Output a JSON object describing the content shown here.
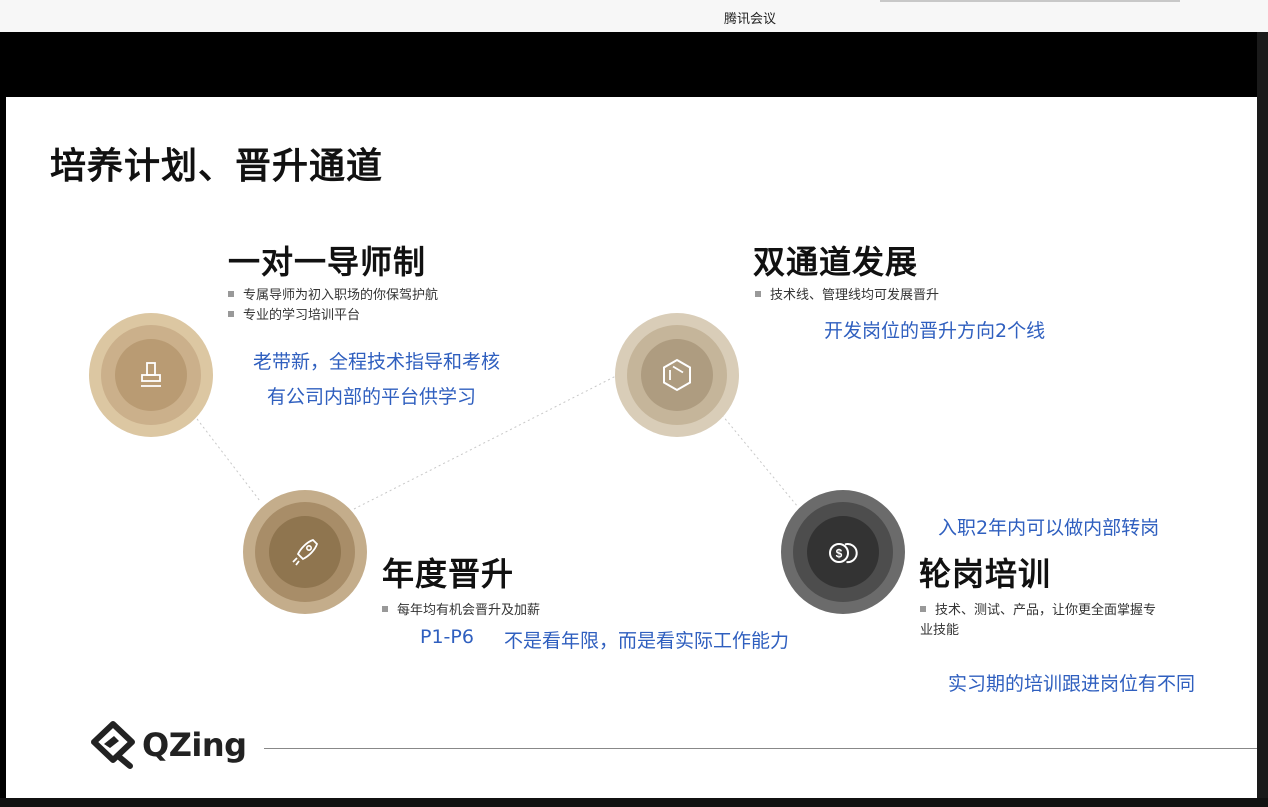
{
  "window": {
    "title": "腾讯会议"
  },
  "slide": {
    "title": "培养计划、晋升通道",
    "sections": [
      {
        "heading": "一对一导师制",
        "bullets": [
          "专属导师为初入职场的你保驾护航",
          "专业的学习培训平台"
        ],
        "icon": "stamp-icon"
      },
      {
        "heading": "双通道发展",
        "bullets": [
          "技术线、管理线均可发展晋升"
        ],
        "icon": "hexagon-icon"
      },
      {
        "heading": "年度晋升",
        "bullets": [
          "每年均有机会晋升及加薪"
        ],
        "icon": "rocket-icon"
      },
      {
        "heading": "轮岗培训",
        "bullets": [
          "技术、测试、产品，让你更全面掌握专业技能"
        ],
        "icon": "coins-icon"
      }
    ],
    "annotations": {
      "mentor_1": "老带新，全程技术指导和考核",
      "mentor_2": "有公司内部的平台供学习",
      "dual_1": "开发岗位的晋升方向2个线",
      "promo_levels": "P1-P6",
      "promo_note": "不是看年限，而是看实际工作能力",
      "rotation_1": "入职2年内可以做内部转岗",
      "rotation_2": "实习期的培训跟进岗位有不同"
    },
    "logo": {
      "text": "QZing"
    },
    "colors": {
      "annotation": "#2f5fbf",
      "gold": "#b99b73",
      "dark": "#333333"
    }
  }
}
